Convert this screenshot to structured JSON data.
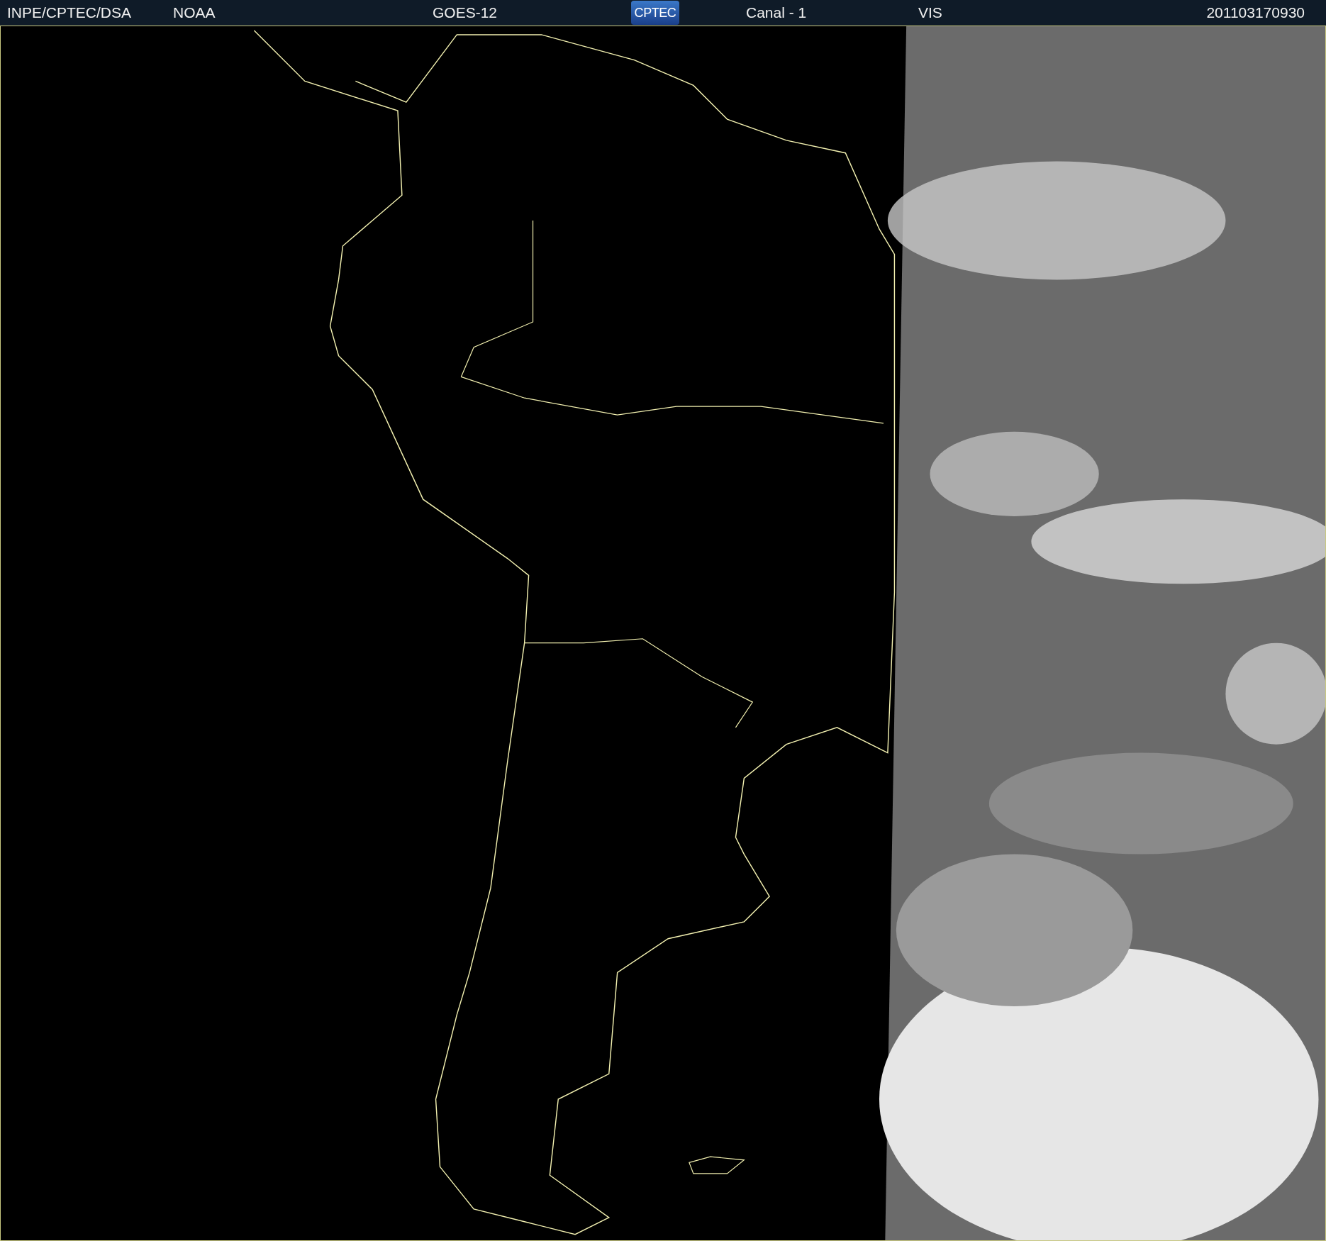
{
  "header": {
    "agency": "INPE/CPTEC/DSA",
    "source": "NOAA",
    "satellite": "GOES-12",
    "logo": "CPTEC",
    "channel": "Canal - 1",
    "band": "VIS",
    "timestamp": "201103170930"
  }
}
